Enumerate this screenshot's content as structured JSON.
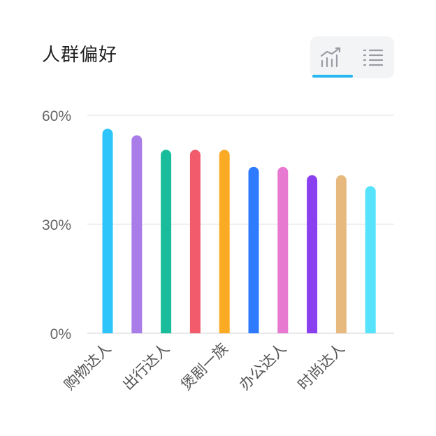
{
  "header": {
    "title": "人群偏好",
    "view_buttons": [
      {
        "name": "chart-view",
        "icon": "trend-chart-icon",
        "active": true
      },
      {
        "name": "list-view",
        "icon": "list-icon",
        "active": false
      }
    ],
    "accent_color": "#27b8f2"
  },
  "chart_data": {
    "type": "bar",
    "title": "",
    "xlabel": "",
    "ylabel": "",
    "ylim": [
      0,
      60
    ],
    "yticks": [
      {
        "value": 0,
        "label": "0%"
      },
      {
        "value": 30,
        "label": "30%"
      },
      {
        "value": 60,
        "label": "60%"
      }
    ],
    "categories": [
      "购物达人",
      "",
      "出行达人",
      "",
      "煲剧一族",
      "",
      "办公达人",
      "",
      "时尚达人",
      ""
    ],
    "values": [
      56.3,
      54.5,
      50.5,
      50.5,
      50.5,
      45.8,
      45.8,
      43.5,
      43.5,
      40.5
    ],
    "colors": [
      "#2ec5fb",
      "#a97de8",
      "#19bd9c",
      "#f15b6c",
      "#fbaa24",
      "#2f7bff",
      "#e879d0",
      "#8a3ff0",
      "#e8b97f",
      "#56e3fb"
    ],
    "grid": true,
    "legend": "none"
  }
}
